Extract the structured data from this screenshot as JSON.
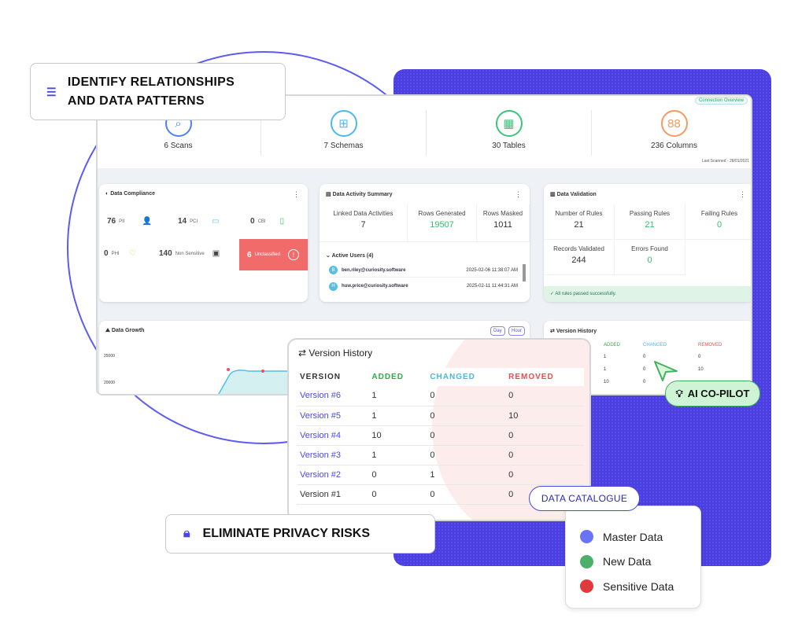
{
  "callouts": {
    "identify": "IDENTIFY RELATIONSHIPS\nAND DATA PATTERNS",
    "privacy": "ELIMINATE PRIVACY RISKS",
    "copilot": "AI CO-PILOT",
    "catalogue": "DATA CATALOGUE"
  },
  "catalogue_items": [
    {
      "label": "Master Data",
      "color": "#6b73f5"
    },
    {
      "label": "New Data",
      "color": "#4caf6a"
    },
    {
      "label": "Sensitive Data",
      "color": "#e03a3a"
    }
  ],
  "overview": {
    "connection_btn": "Connection Overview",
    "last_scanned": "Last Scanned - 28/01/2021",
    "stats": [
      {
        "label": "6 Scans",
        "color": "#4f7ff0",
        "icon": "scan-icon"
      },
      {
        "label": "7 Schemas",
        "color": "#4cb8f0",
        "icon": "schema-icon"
      },
      {
        "label": "30 Tables",
        "color": "#3cc47a",
        "icon": "table-icon"
      },
      {
        "label": "236 Columns",
        "color": "#f39a5e",
        "icon": "columns-icon"
      }
    ]
  },
  "compliance": {
    "title": "Data Compliance",
    "items": [
      {
        "value": "76",
        "label": "PII"
      },
      {
        "value": "14",
        "label": "PCI"
      },
      {
        "value": "0",
        "label": "CBI"
      },
      {
        "value": "0",
        "label": "PHI"
      },
      {
        "value": "140",
        "label": "Non Sensitive"
      },
      {
        "value": "6",
        "label": "Unclassified"
      }
    ]
  },
  "activity": {
    "title": "Data Activity Summary",
    "metrics": [
      {
        "label": "Linked Data Activities",
        "value": "7"
      },
      {
        "label": "Rows Generated",
        "value": "19507"
      },
      {
        "label": "Rows Masked",
        "value": "1011"
      }
    ],
    "active_users_label": "Active Users (4)",
    "users": [
      {
        "initial": "B",
        "email": "ben.riley@curiosity.software",
        "time": "2025-02-06 11:38:07 AM"
      },
      {
        "initial": "H",
        "email": "huw.price@curiosity.software",
        "time": "2025-02-11 11:44:31 AM"
      }
    ]
  },
  "validation": {
    "title": "Data Validation",
    "metrics": [
      {
        "label": "Number of Rules",
        "value": "21"
      },
      {
        "label": "Passing Rules",
        "value": "21"
      },
      {
        "label": "Failing Rules",
        "value": "0"
      },
      {
        "label": "Records Validated",
        "value": "244"
      },
      {
        "label": "Errors Found",
        "value": "0"
      }
    ],
    "status": "✓ All rules passed successfully."
  },
  "growth": {
    "title": "Data Growth",
    "btn_day": "Day",
    "btn_hour": "Hour",
    "y_ticks": [
      "25000",
      "20000"
    ]
  },
  "version_history": {
    "title": "Version History",
    "headers": [
      "VERSION",
      "ADDED",
      "CHANGED",
      "REMOVED"
    ],
    "rows": [
      [
        "Version #6",
        "1",
        "0",
        "0"
      ],
      [
        "Version #5",
        "1",
        "0",
        "10"
      ],
      [
        "Version #4",
        "10",
        "0",
        "0"
      ],
      [
        "Version #3",
        "1",
        "0",
        "0"
      ],
      [
        "Version #2",
        "0",
        "1",
        "0"
      ],
      [
        "Version #1",
        "0",
        "0",
        "0"
      ]
    ],
    "small_rows": [
      [
        "1",
        "0",
        "0"
      ],
      [
        "1",
        "0",
        "10"
      ],
      [
        "10",
        "0",
        ""
      ]
    ]
  },
  "colors": {
    "added": "#22b24c",
    "changed": "#4cb8d8",
    "removed": "#f0484e",
    "link": "#4a4ae0",
    "purple": "#4b3fe0"
  }
}
